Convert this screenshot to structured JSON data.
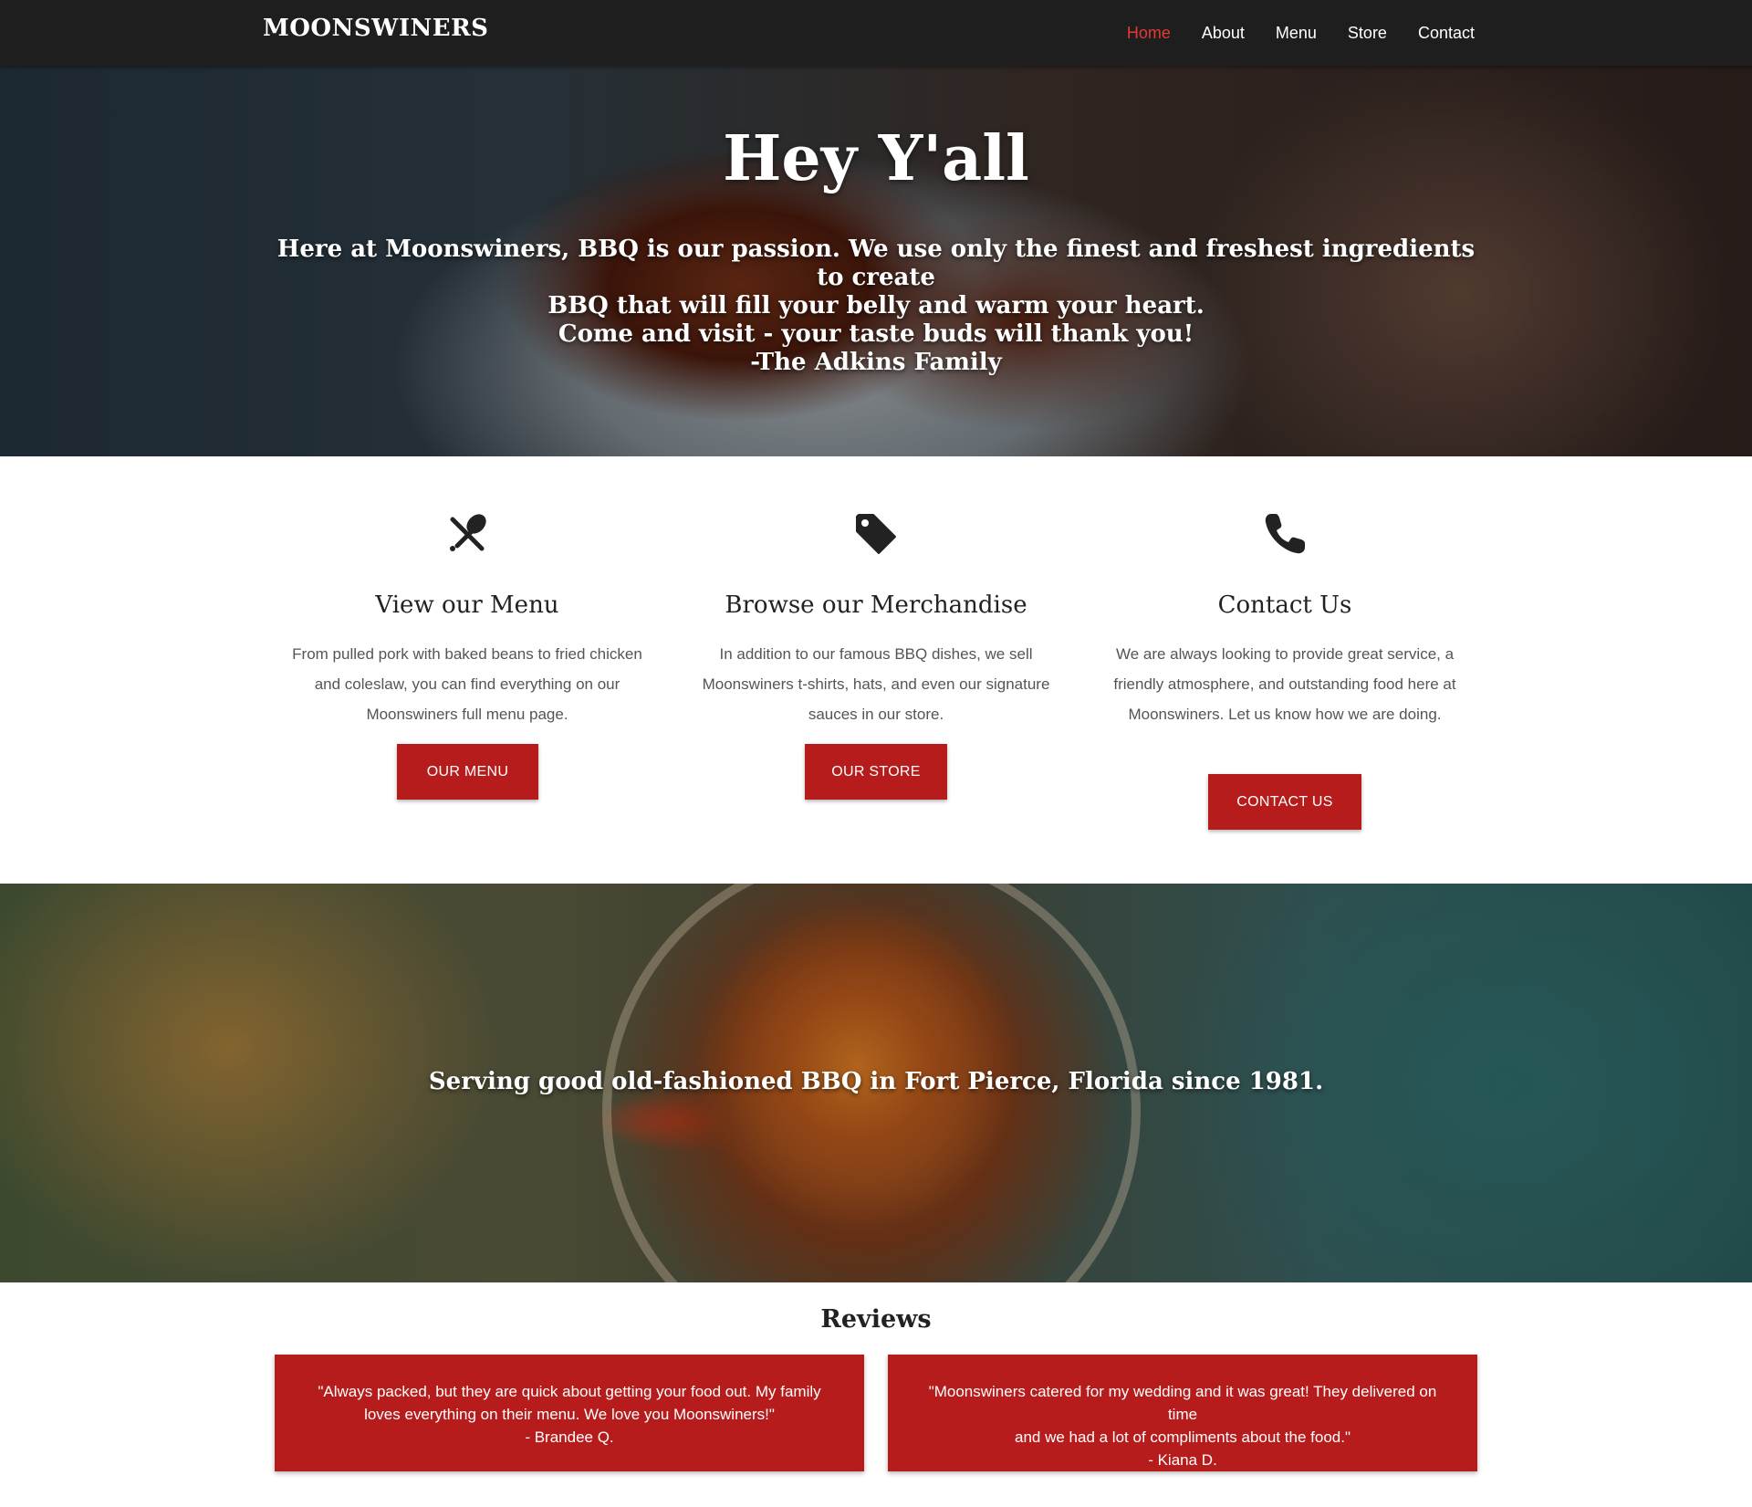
{
  "nav": {
    "brand": "MOONSWINERS",
    "links": [
      {
        "label": "Home",
        "active": true
      },
      {
        "label": "About",
        "active": false
      },
      {
        "label": "Menu",
        "active": false
      },
      {
        "label": "Store",
        "active": false
      },
      {
        "label": "Contact",
        "active": false
      }
    ]
  },
  "hero": {
    "title": "Hey Y'all",
    "lead_line1": "Here at Moonswiners, BBQ is our passion. We use only the finest and freshest ingredients to create",
    "lead_line2": "BBQ that will fill your belly and warm your heart.",
    "lead_line3": "Come and visit - your taste buds will thank you!",
    "signature": "-The Adkins Family"
  },
  "features": [
    {
      "icon": "utensils-icon",
      "title": "View our Menu",
      "text": "From pulled pork with baked beans to fried chicken and coleslaw, you can find everything on our Moonswiners full menu page.",
      "button": "OUR MENU"
    },
    {
      "icon": "tag-icon",
      "title": "Browse our Merchandise",
      "text": "In addition to our famous BBQ dishes, we sell Moonswiners t-shirts, hats, and even our signature sauces in our store.",
      "button": "OUR STORE"
    },
    {
      "icon": "phone-icon",
      "title": "Contact Us",
      "text": "We are always looking to provide great service, a friendly atmosphere, and outstanding food here at Moonswiners. Let us know how we are doing.",
      "button": "CONTACT US"
    }
  ],
  "banner2": {
    "text": "Serving good old-fashioned BBQ in Fort Pierce, Florida since 1981."
  },
  "reviews": {
    "title": "Reviews",
    "items": [
      {
        "line1": "\"Always packed, but they are quick about getting your food out. My family",
        "line2": "loves everything on their menu. We love you Moonswiners!\"",
        "author": "- Brandee Q."
      },
      {
        "line1": "\"Moonswiners catered for my wedding and it was great! They delivered on time",
        "line2": "and we had a lot of compliments about the food.\"",
        "author": "- Kiana D."
      }
    ]
  },
  "colors": {
    "accent": "#b71c1c",
    "nav_active": "#e53935",
    "navbar_bg": "#1e1e1e"
  }
}
